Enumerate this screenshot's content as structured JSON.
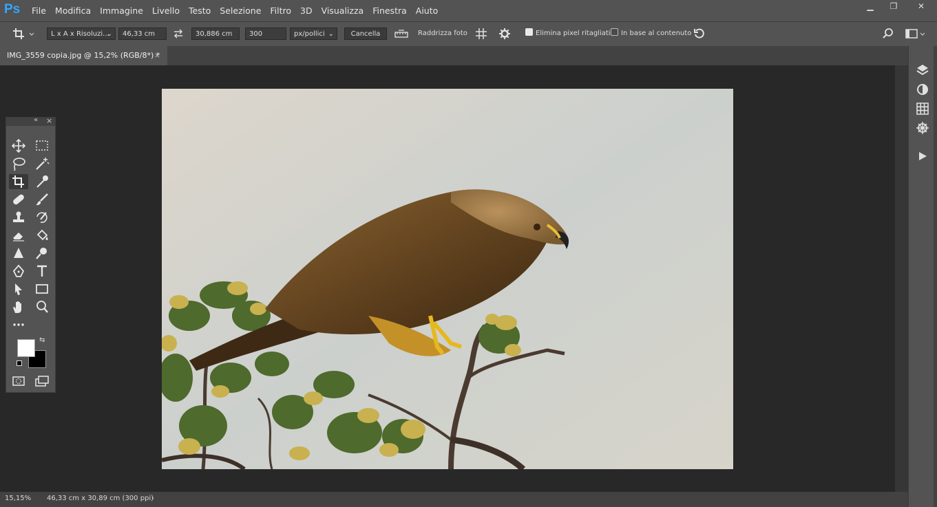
{
  "app": {
    "logo": "Ps"
  },
  "menu": [
    "File",
    "Modifica",
    "Immagine",
    "Livello",
    "Testo",
    "Selezione",
    "Filtro",
    "3D",
    "Visualizza",
    "Finestra",
    "Aiuto"
  ],
  "options": {
    "ratio_select": "L x A x Risoluzi...",
    "width": "46,33 cm",
    "height": "30,886 cm",
    "resolution": "300",
    "units_select": "px/pollici",
    "clear_label": "Cancella",
    "straighten_label": "Raddrizza foto",
    "delete_pixels_label": "Elimina pixel ritagliati",
    "content_aware_label": "In base al contenuto"
  },
  "document": {
    "tab_title": "IMG_3559 copia.jpg @ 15,2% (RGB/8*) *"
  },
  "status": {
    "zoom": "15,15%",
    "info": "46,33 cm x 30,89 cm (300 ppi)"
  },
  "colors": {
    "accent": "#31a8ff",
    "chrome": "#535353",
    "canvas": "#282828"
  }
}
